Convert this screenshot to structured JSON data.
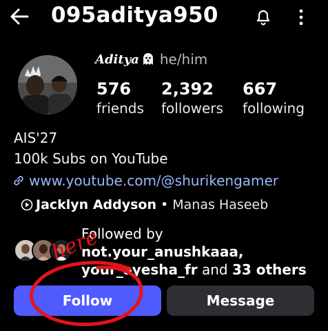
{
  "header": {
    "username": "095aditya950"
  },
  "profile": {
    "display_name": "Aditya",
    "pronouns": "he/him",
    "stats": [
      {
        "value": "576",
        "label": "friends"
      },
      {
        "value": "2,392",
        "label": "followers"
      },
      {
        "value": "667",
        "label": "following"
      }
    ],
    "bio_lines": [
      "AIS'27",
      "100k Subs on YouTube"
    ],
    "link": "www.youtube.com/@shurikengamer",
    "music": {
      "artist": "Jacklyn Addyson",
      "separator": "•",
      "artist2": "Manas Haseeb"
    },
    "followed_by": {
      "intro": "Followed by",
      "user1": "not.your_anushkaaa,",
      "user2": "your_ayesha_fr",
      "suffix_and": "and",
      "others": "33 others"
    }
  },
  "annotation": {
    "scribble_text": "here",
    "color": "#e2141b"
  },
  "buttons": {
    "follow": "Follow",
    "message": "Message"
  },
  "colors": {
    "background": "#000000",
    "follow_button": "#4f5bff",
    "message_button": "#2f2f33",
    "link": "#9bb6ff"
  },
  "icons": [
    "back-arrow-icon",
    "bell-icon",
    "more-vertical-icon",
    "ghost-emoji-icon",
    "link-icon",
    "play-circle-icon"
  ]
}
